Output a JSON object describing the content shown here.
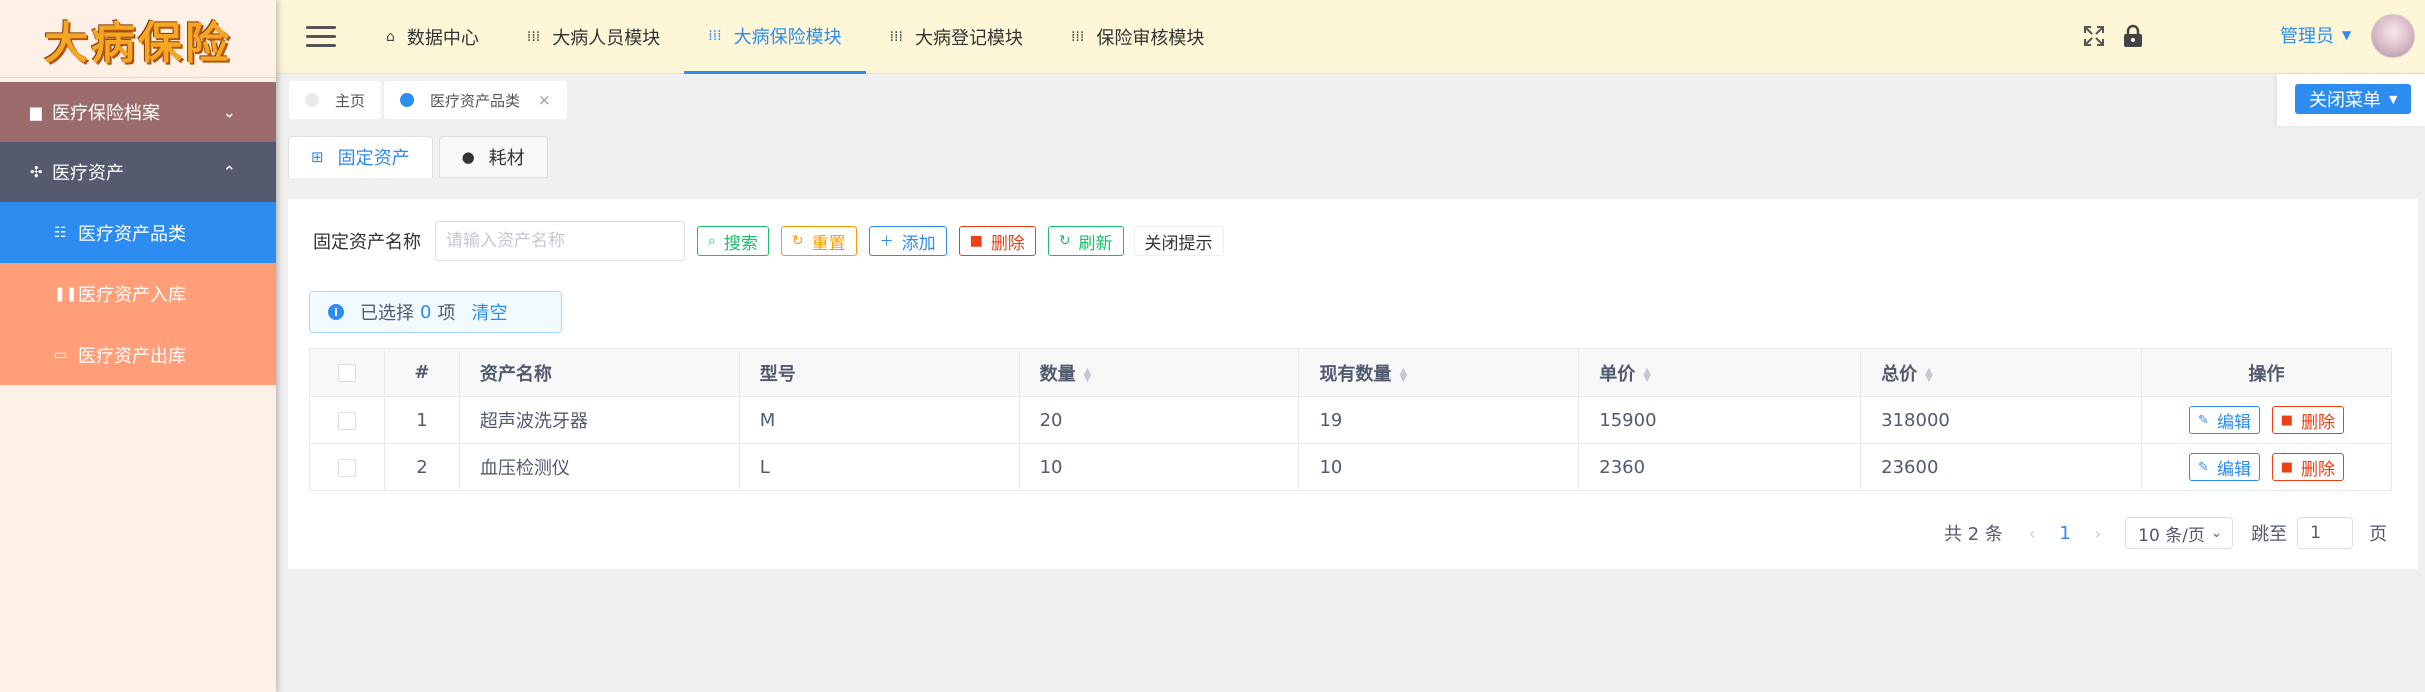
{
  "app": {
    "logo_text": "大病保险"
  },
  "sidebar": {
    "groups": [
      {
        "label": "医疗保险档案",
        "icon": "folder-icon",
        "arrow": "chevron-down-icon"
      },
      {
        "label": "医疗资产",
        "icon": "move-icon",
        "arrow": "chevron-up-icon"
      }
    ],
    "items": [
      {
        "label": "医疗资产品类",
        "icon": "sliders-icon",
        "active": true
      },
      {
        "label": "医疗资产入库",
        "icon": "pause-icon",
        "active": false
      },
      {
        "label": "医疗资产出库",
        "icon": "rectangle-icon",
        "active": false
      }
    ]
  },
  "header": {
    "nav": [
      {
        "label": "数据中心",
        "icon": "home-icon"
      },
      {
        "label": "大病人员模块",
        "icon": "grid-icon"
      },
      {
        "label": "大病保险模块",
        "icon": "grid-icon",
        "active": true
      },
      {
        "label": "大病登记模块",
        "icon": "grid-icon"
      },
      {
        "label": "保险审核模块",
        "icon": "grid-icon"
      }
    ],
    "user_label": "管理员"
  },
  "tabbar": {
    "tabs": [
      {
        "label": "主页",
        "dot_color": "#e8eaec"
      },
      {
        "label": "医疗资产品类",
        "dot_color": "#2d8cf0"
      }
    ],
    "close_menu_label": "关闭菜单"
  },
  "content_tabs": [
    {
      "label": "固定资产",
      "icon": "windows-icon",
      "active": true
    },
    {
      "label": "耗材",
      "icon": "apple-icon",
      "active": false
    }
  ],
  "search": {
    "label": "固定资产名称",
    "placeholder": "请输入资产名称",
    "buttons": {
      "search": "搜索",
      "reset": "重置",
      "add": "添加",
      "delete": "删除",
      "refresh": "刷新",
      "close_tip": "关闭提示"
    }
  },
  "selection": {
    "prefix": "已选择",
    "count": "0",
    "suffix": "项",
    "clear": "清空"
  },
  "table": {
    "columns": [
      "#",
      "资产名称",
      "型号",
      "数量",
      "现有数量",
      "单价",
      "总价",
      "操作"
    ],
    "rows": [
      {
        "index": "1",
        "name": "超声波洗牙器",
        "model": "M",
        "qty": "20",
        "current_qty": "19",
        "unit_price": "15900",
        "total": "318000"
      },
      {
        "index": "2",
        "name": "血压检测仪",
        "model": "L",
        "qty": "10",
        "current_qty": "10",
        "unit_price": "2360",
        "total": "23600"
      }
    ],
    "row_actions": {
      "edit": "编辑",
      "delete": "删除"
    }
  },
  "pager": {
    "total": "共 2 条",
    "current_page": "1",
    "page_size": "10 条/页",
    "jump_label": "跳至",
    "jump_value": "1",
    "page_suffix": "页"
  }
}
